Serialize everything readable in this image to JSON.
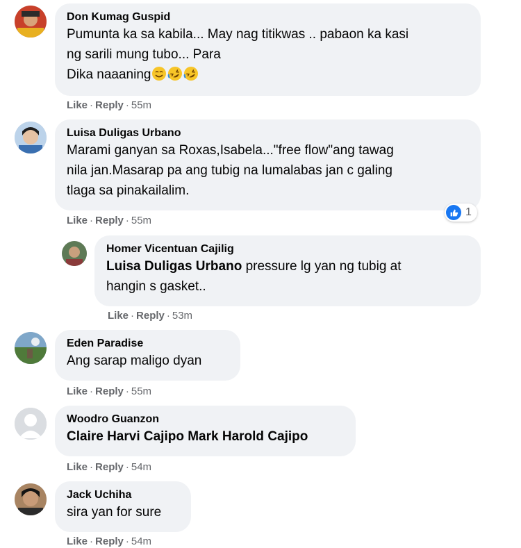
{
  "comments": [
    {
      "author": "Don Kumag Guspid",
      "text": "Pumunta ka sa kabila... May nag titikwas .. pabaon ka kasi\nng sarili mung tubo... Para\nDika naaaning",
      "emoji": [
        "smiling-face-icon",
        "rolling-laughing-icon",
        "rolling-laughing-icon"
      ],
      "actions": {
        "like": "Like",
        "reply": "Reply",
        "time": "55m"
      }
    },
    {
      "author": "Luisa Duligas Urbano",
      "text": "Marami ganyan sa Roxas,Isabela...\"free flow\"ang tawag\nnila jan.Masarap pa ang tubig na lumalabas jan c galing\ntlaga sa pinakailalim.",
      "reaction_count": "1",
      "actions": {
        "like": "Like",
        "reply": "Reply",
        "time": "55m"
      }
    },
    {
      "author": "Homer Vicentuan Cajilig",
      "mention": "Luisa Duligas Urbano",
      "text": " pressure lg yan ng tubig at\nhangin s gasket..",
      "actions": {
        "like": "Like",
        "reply": "Reply",
        "time": "53m"
      }
    },
    {
      "author": "Eden Paradise",
      "text": "Ang sarap maligo dyan",
      "actions": {
        "like": "Like",
        "reply": "Reply",
        "time": "55m"
      }
    },
    {
      "author": "Woodro Guanzon",
      "mention": "Claire Harvi Cajipo Mark Harold Cajipo",
      "actions": {
        "like": "Like",
        "reply": "Reply",
        "time": "54m"
      }
    },
    {
      "author": "Jack Uchiha",
      "text": "sira yan for sure",
      "actions": {
        "like": "Like",
        "reply": "Reply",
        "time": "54m"
      }
    }
  ],
  "colors": {
    "bubble": "#f0f2f5",
    "meta": "#65676b",
    "like_blue": "#1877f2"
  }
}
